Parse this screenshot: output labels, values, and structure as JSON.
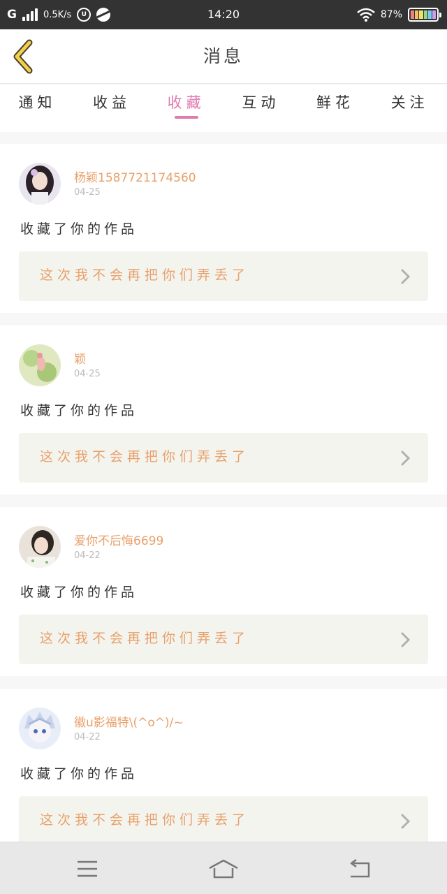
{
  "status_bar": {
    "network": "G",
    "speed": "0.5K/s",
    "time": "14:20",
    "battery": "87%"
  },
  "header": {
    "title": "消息",
    "back_icon": "chevron-left-icon"
  },
  "tabs": [
    {
      "label": "通知",
      "active": false
    },
    {
      "label": "收益",
      "active": false
    },
    {
      "label": "收藏",
      "active": true
    },
    {
      "label": "互动",
      "active": false
    },
    {
      "label": "鲜花",
      "active": false
    },
    {
      "label": "关注",
      "active": false
    }
  ],
  "colors": {
    "accent_pink": "#e07ab0",
    "name_orange": "#e8a06a",
    "card_bg": "#f4f4ef"
  },
  "feed": [
    {
      "username": "杨颖1587721174560",
      "date": "04-25",
      "action": "收藏了你的作品",
      "work_title": "这次我不会再把你们弄丢了"
    },
    {
      "username": "颖",
      "date": "04-25",
      "action": "收藏了你的作品",
      "work_title": "这次我不会再把你们弄丢了"
    },
    {
      "username": "爱你不后悔6699",
      "date": "04-22",
      "action": "收藏了你的作品",
      "work_title": "这次我不会再把你们弄丢了"
    },
    {
      "username": "徽u影福特\\(^o^)/~",
      "date": "04-22",
      "action": "收藏了你的作品",
      "work_title": "这次我不会再把你们弄丢了"
    }
  ],
  "bottom_nav": [
    "menu-icon",
    "home-icon",
    "back-icon"
  ]
}
